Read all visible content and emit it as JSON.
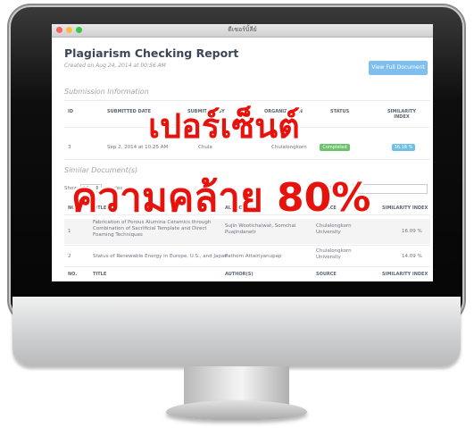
{
  "window": {
    "title": "ดีเซอร์บิ้ลีย์"
  },
  "header": {
    "title": "Plagiarism Checking Report",
    "created": "Created on Aug 24, 2014 at 00:56 AM",
    "view_button": "View Full Document"
  },
  "submission": {
    "section_title": "Submission Information",
    "columns": [
      "ID",
      "SUBMITTED DATE",
      "SUBMITTED BY",
      "ORGANIZATION",
      "STATUS",
      "SIMILARITY INDEX"
    ],
    "row": {
      "id": "3",
      "date": "Sep 2, 2014 at 10:25 AM",
      "by": "Chula",
      "org": "Chulalongkorn",
      "status": "Completed",
      "similarity": "36.18 %"
    }
  },
  "similar": {
    "section_title": "Similar Document(s)",
    "show_label": "Show",
    "show_value": "10",
    "entries_label": "entries",
    "search_label": "Search:",
    "columns": [
      "NO.",
      "TITLE",
      "AUTHOR(S)",
      "SOURCE",
      "SIMILARITY INDEX"
    ],
    "rows": [
      {
        "no": "1",
        "title": "Fabrication of Porous Alumina Ceramics through Combination of Sacrificial Template and Direct Foaming Techniques",
        "authors": "Sujin Wootichaiwat, Somchai Puajindanetr",
        "source": "Chulalongkorn University",
        "similarity": "16.09 %"
      },
      {
        "no": "2",
        "title": "Status of Renewable Energy in Europe, U.S., and Japan",
        "authors": "Pathorn Attairiyanupap",
        "source": "Chulalongkorn University",
        "similarity": "14.09 %"
      }
    ],
    "footer_columns": [
      "NO.",
      "TITLE",
      "AUTHOR(S)",
      "SOURCE",
      "SIMILARITY INDEX"
    ]
  },
  "overlay": {
    "line1": "เปอร์เซ็นต์",
    "line2": "ความคล้าย 80%"
  }
}
